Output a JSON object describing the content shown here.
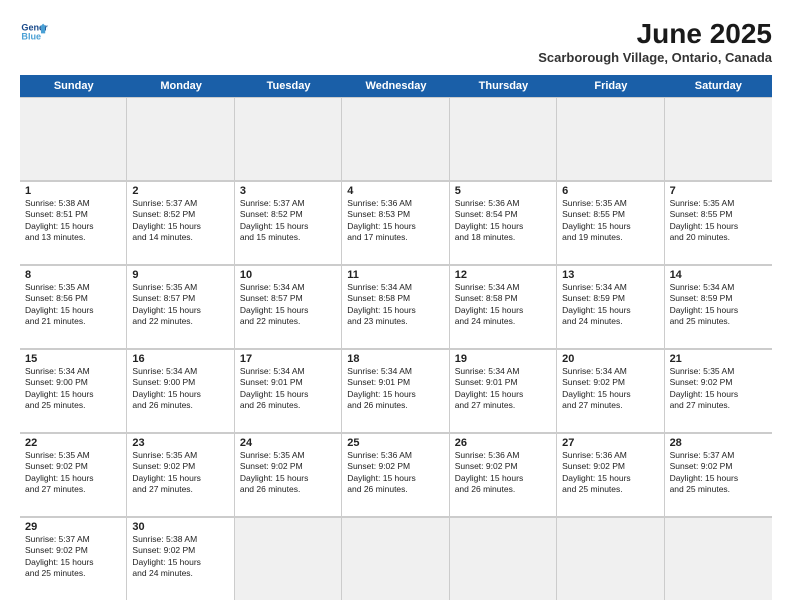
{
  "header": {
    "logo_line1": "General",
    "logo_line2": "Blue",
    "month": "June 2025",
    "location": "Scarborough Village, Ontario, Canada"
  },
  "days_of_week": [
    "Sunday",
    "Monday",
    "Tuesday",
    "Wednesday",
    "Thursday",
    "Friday",
    "Saturday"
  ],
  "rows": [
    [
      null,
      null,
      null,
      null,
      null,
      null,
      null
    ]
  ],
  "cells": [
    [
      {
        "day": null,
        "empty": true
      },
      {
        "day": null,
        "empty": true
      },
      {
        "day": null,
        "empty": true
      },
      {
        "day": null,
        "empty": true
      },
      {
        "day": null,
        "empty": true
      },
      {
        "day": null,
        "empty": true
      },
      {
        "day": null,
        "empty": true
      }
    ],
    [
      {
        "day": "1",
        "lines": [
          "Sunrise: 5:38 AM",
          "Sunset: 8:51 PM",
          "Daylight: 15 hours",
          "and 13 minutes."
        ]
      },
      {
        "day": "2",
        "lines": [
          "Sunrise: 5:37 AM",
          "Sunset: 8:52 PM",
          "Daylight: 15 hours",
          "and 14 minutes."
        ]
      },
      {
        "day": "3",
        "lines": [
          "Sunrise: 5:37 AM",
          "Sunset: 8:52 PM",
          "Daylight: 15 hours",
          "and 15 minutes."
        ]
      },
      {
        "day": "4",
        "lines": [
          "Sunrise: 5:36 AM",
          "Sunset: 8:53 PM",
          "Daylight: 15 hours",
          "and 17 minutes."
        ]
      },
      {
        "day": "5",
        "lines": [
          "Sunrise: 5:36 AM",
          "Sunset: 8:54 PM",
          "Daylight: 15 hours",
          "and 18 minutes."
        ]
      },
      {
        "day": "6",
        "lines": [
          "Sunrise: 5:35 AM",
          "Sunset: 8:55 PM",
          "Daylight: 15 hours",
          "and 19 minutes."
        ]
      },
      {
        "day": "7",
        "lines": [
          "Sunrise: 5:35 AM",
          "Sunset: 8:55 PM",
          "Daylight: 15 hours",
          "and 20 minutes."
        ]
      }
    ],
    [
      {
        "day": "8",
        "lines": [
          "Sunrise: 5:35 AM",
          "Sunset: 8:56 PM",
          "Daylight: 15 hours",
          "and 21 minutes."
        ]
      },
      {
        "day": "9",
        "lines": [
          "Sunrise: 5:35 AM",
          "Sunset: 8:57 PM",
          "Daylight: 15 hours",
          "and 22 minutes."
        ]
      },
      {
        "day": "10",
        "lines": [
          "Sunrise: 5:34 AM",
          "Sunset: 8:57 PM",
          "Daylight: 15 hours",
          "and 22 minutes."
        ]
      },
      {
        "day": "11",
        "lines": [
          "Sunrise: 5:34 AM",
          "Sunset: 8:58 PM",
          "Daylight: 15 hours",
          "and 23 minutes."
        ]
      },
      {
        "day": "12",
        "lines": [
          "Sunrise: 5:34 AM",
          "Sunset: 8:58 PM",
          "Daylight: 15 hours",
          "and 24 minutes."
        ]
      },
      {
        "day": "13",
        "lines": [
          "Sunrise: 5:34 AM",
          "Sunset: 8:59 PM",
          "Daylight: 15 hours",
          "and 24 minutes."
        ]
      },
      {
        "day": "14",
        "lines": [
          "Sunrise: 5:34 AM",
          "Sunset: 8:59 PM",
          "Daylight: 15 hours",
          "and 25 minutes."
        ]
      }
    ],
    [
      {
        "day": "15",
        "lines": [
          "Sunrise: 5:34 AM",
          "Sunset: 9:00 PM",
          "Daylight: 15 hours",
          "and 25 minutes."
        ]
      },
      {
        "day": "16",
        "lines": [
          "Sunrise: 5:34 AM",
          "Sunset: 9:00 PM",
          "Daylight: 15 hours",
          "and 26 minutes."
        ]
      },
      {
        "day": "17",
        "lines": [
          "Sunrise: 5:34 AM",
          "Sunset: 9:01 PM",
          "Daylight: 15 hours",
          "and 26 minutes."
        ]
      },
      {
        "day": "18",
        "lines": [
          "Sunrise: 5:34 AM",
          "Sunset: 9:01 PM",
          "Daylight: 15 hours",
          "and 26 minutes."
        ]
      },
      {
        "day": "19",
        "lines": [
          "Sunrise: 5:34 AM",
          "Sunset: 9:01 PM",
          "Daylight: 15 hours",
          "and 27 minutes."
        ]
      },
      {
        "day": "20",
        "lines": [
          "Sunrise: 5:34 AM",
          "Sunset: 9:02 PM",
          "Daylight: 15 hours",
          "and 27 minutes."
        ]
      },
      {
        "day": "21",
        "lines": [
          "Sunrise: 5:35 AM",
          "Sunset: 9:02 PM",
          "Daylight: 15 hours",
          "and 27 minutes."
        ]
      }
    ],
    [
      {
        "day": "22",
        "lines": [
          "Sunrise: 5:35 AM",
          "Sunset: 9:02 PM",
          "Daylight: 15 hours",
          "and 27 minutes."
        ]
      },
      {
        "day": "23",
        "lines": [
          "Sunrise: 5:35 AM",
          "Sunset: 9:02 PM",
          "Daylight: 15 hours",
          "and 27 minutes."
        ]
      },
      {
        "day": "24",
        "lines": [
          "Sunrise: 5:35 AM",
          "Sunset: 9:02 PM",
          "Daylight: 15 hours",
          "and 26 minutes."
        ]
      },
      {
        "day": "25",
        "lines": [
          "Sunrise: 5:36 AM",
          "Sunset: 9:02 PM",
          "Daylight: 15 hours",
          "and 26 minutes."
        ]
      },
      {
        "day": "26",
        "lines": [
          "Sunrise: 5:36 AM",
          "Sunset: 9:02 PM",
          "Daylight: 15 hours",
          "and 26 minutes."
        ]
      },
      {
        "day": "27",
        "lines": [
          "Sunrise: 5:36 AM",
          "Sunset: 9:02 PM",
          "Daylight: 15 hours",
          "and 25 minutes."
        ]
      },
      {
        "day": "28",
        "lines": [
          "Sunrise: 5:37 AM",
          "Sunset: 9:02 PM",
          "Daylight: 15 hours",
          "and 25 minutes."
        ]
      }
    ],
    [
      {
        "day": "29",
        "lines": [
          "Sunrise: 5:37 AM",
          "Sunset: 9:02 PM",
          "Daylight: 15 hours",
          "and 25 minutes."
        ]
      },
      {
        "day": "30",
        "lines": [
          "Sunrise: 5:38 AM",
          "Sunset: 9:02 PM",
          "Daylight: 15 hours",
          "and 24 minutes."
        ]
      },
      {
        "day": null,
        "empty": true
      },
      {
        "day": null,
        "empty": true
      },
      {
        "day": null,
        "empty": true
      },
      {
        "day": null,
        "empty": true
      },
      {
        "day": null,
        "empty": true
      }
    ]
  ]
}
